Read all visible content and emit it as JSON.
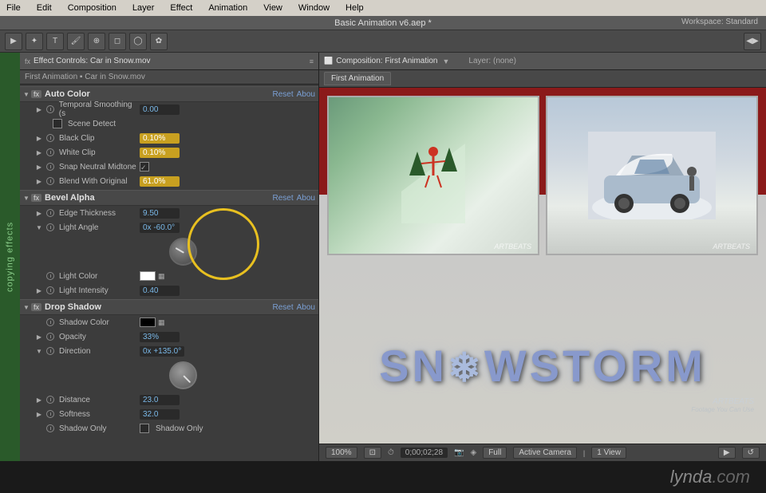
{
  "app": {
    "title": "Basic Animation v6.aep *",
    "workspace_label": "Workspace:",
    "workspace_value": "Standard"
  },
  "menu": {
    "items": [
      "File",
      "Edit",
      "Composition",
      "Layer",
      "Effect",
      "Animation",
      "View",
      "Window",
      "Help"
    ]
  },
  "effect_controls": {
    "panel_title": "Effect Controls: Car in Snow.mov",
    "breadcrumb": "First Animation ▪ Car in Snow.mov",
    "sections": [
      {
        "name": "Auto Color",
        "reset_label": "Reset",
        "about_label": "About",
        "params": [
          {
            "name": "Temporal Smoothing (s",
            "value": "0.00"
          },
          {
            "name": "Scene Detect",
            "type": "checkbox"
          },
          {
            "name": "Black Clip",
            "value": "0.10%"
          },
          {
            "name": "White Clip",
            "value": "0.10%"
          },
          {
            "name": "Snap Neutral Midtone",
            "type": "checkbox"
          },
          {
            "name": "Blend With Original",
            "value": "61.0%",
            "highlighted": true
          }
        ]
      },
      {
        "name": "Bevel Alpha",
        "reset_label": "Reset",
        "about_label": "About",
        "params": [
          {
            "name": "Edge Thickness",
            "value": "9.50"
          },
          {
            "name": "Light Angle",
            "value": "0x -60.0°"
          },
          {
            "name": "Light Color",
            "type": "color",
            "color": "white"
          },
          {
            "name": "Light Intensity",
            "value": "0.40"
          }
        ]
      },
      {
        "name": "Drop Shadow",
        "reset_label": "Reset",
        "about_label": "About",
        "params": [
          {
            "name": "Shadow Color",
            "type": "color",
            "color": "black"
          },
          {
            "name": "Opacity",
            "value": "33%"
          },
          {
            "name": "Direction",
            "value": "0x +135.0°"
          },
          {
            "name": "Distance",
            "value": "23.0"
          },
          {
            "name": "Softness",
            "value": "32.0"
          },
          {
            "name": "Shadow Only",
            "type": "checkbox",
            "label": "Shadow Only"
          }
        ]
      }
    ]
  },
  "composition": {
    "panel_title": "Composition: First Animation",
    "layer_label": "Layer: (none)",
    "tab_label": "First Animation",
    "snowstorm_text": "SN",
    "snowstorm_middle": "❄",
    "snowstorm_end": "WSTORM",
    "artbeats_label": "ARTBEATS",
    "artbeats_tagline": "Footage You Can Use"
  },
  "bottom_bar": {
    "zoom": "100%",
    "timecode": "0;00;02;28",
    "quality": "Full",
    "camera": "Active Camera",
    "view": "1 View"
  },
  "footer": {
    "brand": "lynda",
    "tld": ".com"
  }
}
